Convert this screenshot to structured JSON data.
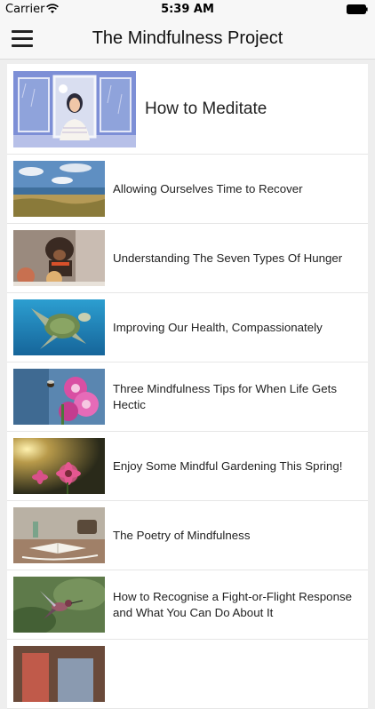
{
  "status": {
    "carrier": "Carrier",
    "time": "5:39 AM"
  },
  "nav": {
    "title": "The Mindfulness Project"
  },
  "featured": {
    "label": "How to Meditate",
    "image_icon": "meditating-woman-illustration"
  },
  "articles": [
    {
      "label": "Allowing Ourselves Time to Recover",
      "image_icon": "seaside-landscape"
    },
    {
      "label": "Understanding The Seven Types Of Hunger",
      "image_icon": "dog-with-food"
    },
    {
      "label": "Improving Our Health, Compassionately",
      "image_icon": "sea-turtle"
    },
    {
      "label": "Three Mindfulness Tips for When Life Gets Hectic",
      "image_icon": "bee-on-flowers"
    },
    {
      "label": "Enjoy Some Mindful Gardening This Spring!",
      "image_icon": "pink-flowers-sunset"
    },
    {
      "label": "The Poetry of Mindfulness",
      "image_icon": "book-on-table"
    },
    {
      "label": "How to Recognise a Fight-or-Flight Response and What You Can Do About It",
      "image_icon": "hummingbird"
    }
  ],
  "colors": {
    "nav_background": "#f7f7f7",
    "page_background": "#eeeeee",
    "row_background": "#ffffff"
  }
}
